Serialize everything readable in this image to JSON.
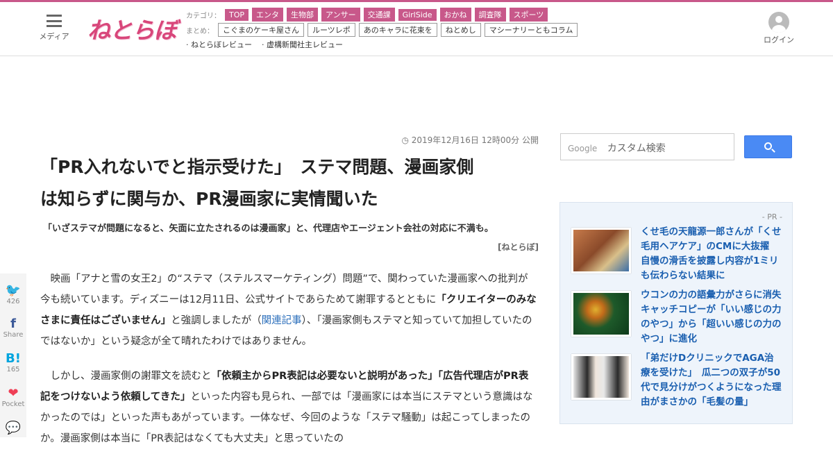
{
  "header": {
    "menu_label": "メディア",
    "logo_text": "ねとらぼ",
    "categories_label": "カテゴリ：",
    "categories": [
      "TOP",
      "エンタ",
      "生物部",
      "アンサー",
      "交通課",
      "GirlSide",
      "おかね",
      "調査隊",
      "スポーツ"
    ],
    "summary_label": "まとめ：",
    "summaries": [
      "こぐまのケーキ屋さん",
      "ルーツレポ",
      "あのキャラに花束を",
      "ねとめし",
      "マシーナリーともコラム"
    ],
    "reviews": [
      "· ねとらぼレビュー",
      "· 虚構新聞社主レビュー"
    ],
    "login_label": "ログイン"
  },
  "article": {
    "date": "2019年12月16日 12時00分 公開",
    "title_line1": "「PR入れないでと指示受けた」　ステマ問題、漫画家側",
    "title_line2": "は知らずに関与か、PR漫画家に実情聞いた",
    "subtitle": "「いざステマが問題になると、矢面に立たされるのは漫画家」と、代理店やエージェント会社の対応に不満も。",
    "source": "[ねとらぼ]",
    "p1_a": "映画「アナと雪の女王2」の“ステマ（ステルスマーケティング）問題”で、関わっていた漫画家への批判が今も続いています。ディズニーは12月11日、公式サイトであらためて謝罪するとともに",
    "p1_bold": "「クリエイターのみなさまに責任はございません」",
    "p1_b": "と強調しましたが（",
    "p1_link": "関連記事",
    "p1_c": "）、「漫画家側もステマと知っていて加担していたのではないか」という疑念が全て晴れたわけではありません。",
    "p2_a": "しかし、漫画家側の謝罪文を読むと",
    "p2_bold": "「依頼主からPR表記は必要ないと説明があった」「広告代理店がPR表記をつけないよう依頼してきた」",
    "p2_b": "といった内容も見られ、一部では「漫画家には本当にステマという意識はなかったのでは」といった声もあがっています。一体なぜ、今回のような「ステマ騒動」は起こってしまったのか。漫画家側は本当に「PR表記はなくても大丈夫」と思っていたの"
  },
  "share": {
    "twitter_count": "426",
    "facebook_label": "Share",
    "hatena_count": "165",
    "pocket_label": "Pocket"
  },
  "search": {
    "google_label": "Google",
    "placeholder": "カスタム検索"
  },
  "pr": {
    "label": "- PR -",
    "items": [
      {
        "text": "くせ毛の天龍源一郎さんが「くせ毛用ヘアケア」のCMに大抜擢　自慢の滑舌を披露し内容が1ミリも伝わらない結果に"
      },
      {
        "text": "ウコンの力の語彙力がさらに消失　キャッチコピーが「いい感じの力のやつ」から「超いい感じの力のやつ」に進化"
      },
      {
        "text": "「弟だけDクリニックでAGA治療を受けた」　瓜二つの双子が50代で見分けがつくようになった理由がまさかの「毛髪の量」"
      }
    ]
  },
  "colors": {
    "accent": "#c8588a",
    "link": "#2a6ebb",
    "pr_link": "#1a5fb0"
  }
}
